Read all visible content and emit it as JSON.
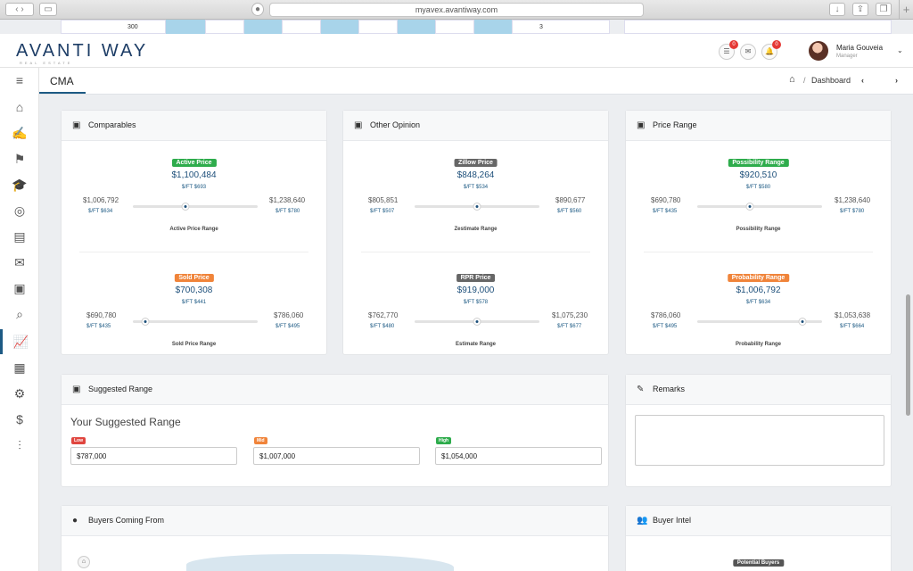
{
  "browser": {
    "url": "myavex.avantiway.com"
  },
  "strip": {
    "left_value": "300",
    "mid_value": "3"
  },
  "header": {
    "logo": "AVANTI WAY",
    "logo_sub": "REAL ESTATE",
    "list_badge": "0",
    "bell_badge": "0",
    "user_name": "Maria Gouveia",
    "user_role": "Manager"
  },
  "page": {
    "title": "CMA",
    "breadcrumb": "Dashboard"
  },
  "comparables": {
    "title": "Comparables",
    "active": {
      "label": "Active Price",
      "value": "$1,100,484",
      "sqft": "$/FT $693",
      "low": "$1,006,792",
      "low_sqft": "$/FT $634",
      "high": "$1,238,640",
      "high_sqft": "$/FT $780",
      "range_name": "Active Price Range",
      "position": 0.42
    },
    "sold": {
      "label": "Sold Price",
      "value": "$700,308",
      "sqft": "$/FT $441",
      "low": "$690,780",
      "low_sqft": "$/FT $435",
      "high": "$786,060",
      "high_sqft": "$/FT $495",
      "range_name": "Sold Price Range",
      "position": 0.1
    }
  },
  "other_opinion": {
    "title": "Other Opinion",
    "zillow": {
      "label": "Zillow Price",
      "value": "$848,264",
      "sqft": "$/FT $534",
      "low": "$805,851",
      "low_sqft": "$/FT $507",
      "high": "$890,677",
      "high_sqft": "$/FT $560",
      "range_name": "Zestimate Range",
      "position": 0.5
    },
    "rpr": {
      "label": "RPR Price",
      "value": "$919,000",
      "sqft": "$/FT $578",
      "low": "$762,770",
      "low_sqft": "$/FT $480",
      "high": "$1,075,230",
      "high_sqft": "$/FT $677",
      "range_name": "Estimate Range",
      "position": 0.5
    }
  },
  "price_range": {
    "title": "Price Range",
    "possibility": {
      "label": "Possibility Range",
      "value": "$920,510",
      "sqft": "$/FT $580",
      "low": "$690,780",
      "low_sqft": "$/FT $435",
      "high": "$1,238,640",
      "high_sqft": "$/FT $780",
      "range_name": "Possibility Range",
      "position": 0.42
    },
    "probability": {
      "label": "Probability Range",
      "value": "$1,006,792",
      "sqft": "$/FT $634",
      "low": "$786,060",
      "low_sqft": "$/FT $495",
      "high": "$1,053,638",
      "high_sqft": "$/FT $664",
      "range_name": "Probability Range",
      "position": 0.84
    }
  },
  "suggested": {
    "title": "Suggested Range",
    "subtitle": "Your Suggested Range",
    "low_tag": "Low",
    "low_value": "$787,000",
    "mid_tag": "Mid",
    "mid_value": "$1,007,000",
    "high_tag": "High",
    "high_value": "$1,054,000"
  },
  "remarks": {
    "title": "Remarks",
    "value": ""
  },
  "buyers_from": {
    "title": "Buyers Coming From"
  },
  "buyer_intel": {
    "title": "Buyer Intel",
    "label": "Potential Buyers"
  },
  "colors": {
    "accent": "#1d5a84",
    "active": "#2eac4c",
    "sold": "#f0843a",
    "neutral": "#666666",
    "low": "#e0463f"
  }
}
